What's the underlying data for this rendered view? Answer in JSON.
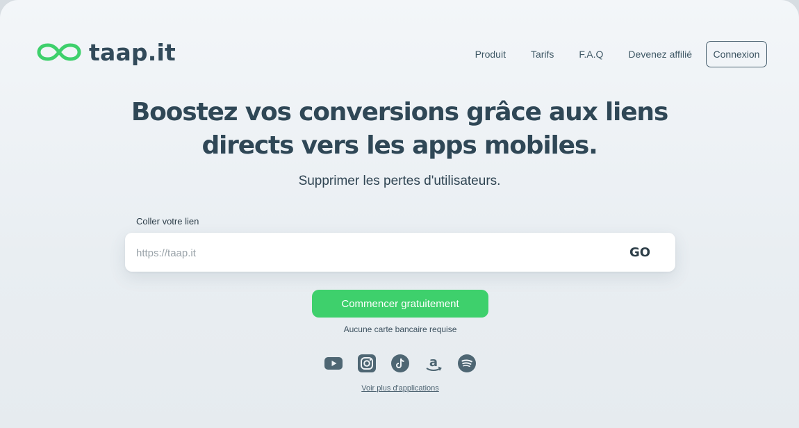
{
  "brand": {
    "name": "taap.it",
    "accent_color": "#3ed06c",
    "text_color": "#324a5a"
  },
  "nav": {
    "items": [
      "Produit",
      "Tarifs",
      "F.A.Q",
      "Devenez affilié"
    ],
    "login_label": "Connexion"
  },
  "hero": {
    "title_line1": "Boostez vos conversions grâce aux liens",
    "title_line2": "directs vers les apps mobiles.",
    "subtitle": "Supprimer les pertes d'utilisateurs."
  },
  "link_form": {
    "label": "Coller votre lien",
    "placeholder": "https://taap.it",
    "value": "",
    "submit_label": "GO"
  },
  "cta": {
    "label": "Commencer gratuitement",
    "note": "Aucune carte bancaire requise"
  },
  "apps": {
    "icons": [
      "youtube-icon",
      "instagram-icon",
      "tiktok-icon",
      "amazon-icon",
      "spotify-icon"
    ],
    "more_label": "Voir plus d'applications"
  }
}
